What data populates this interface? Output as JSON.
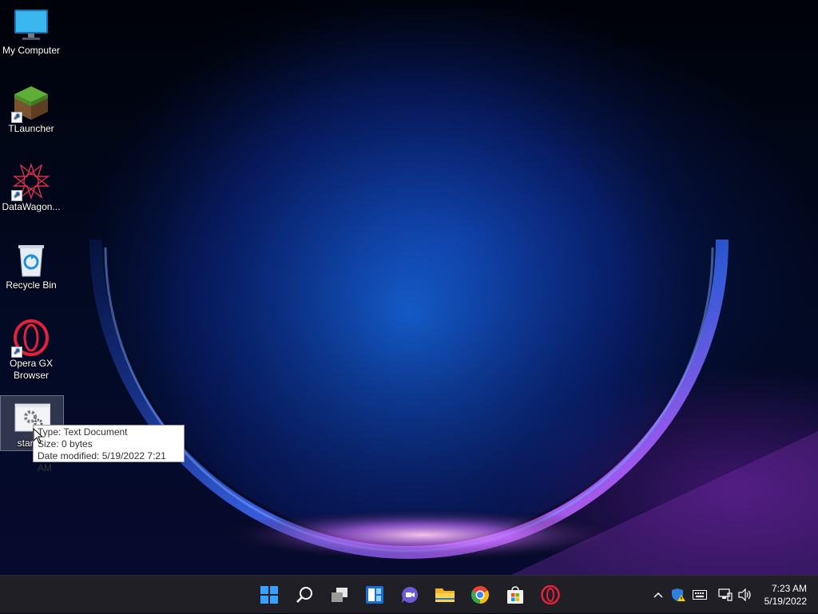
{
  "desktop": {
    "icons": [
      {
        "label": "My Computer",
        "icon": "monitor-icon"
      },
      {
        "label": "TLauncher",
        "icon": "grass-block-icon",
        "shortcut": true
      },
      {
        "label": "DataWagon...",
        "icon": "starburst-icon",
        "shortcut": true
      },
      {
        "label": "Recycle Bin",
        "icon": "recycle-bin-icon"
      },
      {
        "label": "Opera GX Browser",
        "icon": "opera-gx-icon",
        "shortcut": true
      },
      {
        "label": "start m",
        "icon": "settings-file-icon"
      }
    ],
    "shortcut_arrow": "↗"
  },
  "tooltip": {
    "type": "Type: Text Document",
    "size": "Size: 0 bytes",
    "modified": "Date modified: 5/19/2022 7:21 AM"
  },
  "taskbar": {
    "apps": [
      "start-icon",
      "search-icon",
      "task-view-icon",
      "widgets-icon",
      "chat-icon",
      "file-explorer-icon",
      "chrome-icon",
      "store-icon",
      "opera-icon"
    ],
    "tray": [
      "chevron-up-icon",
      "security-warning-icon",
      "keyboard-icon",
      "network-icon",
      "volume-icon"
    ],
    "time": "7:23 AM",
    "date": "5/19/2022"
  },
  "colors": {
    "taskbar_bg": "#1f1f25",
    "start_blue": "#3aa0ff",
    "opera_red": "#e4213b"
  }
}
